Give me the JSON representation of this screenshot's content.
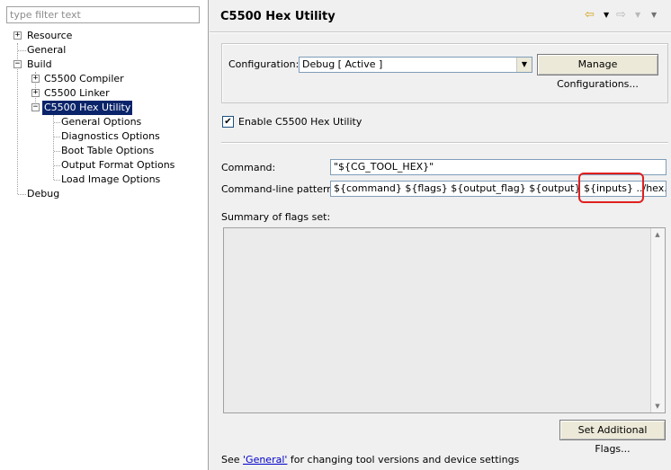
{
  "filter": {
    "placeholder": "type filter text"
  },
  "tree": {
    "resource": "Resource",
    "general": "General",
    "build": "Build",
    "compiler": "C5500 Compiler",
    "linker": "C5500 Linker",
    "hex_utility": "C5500 Hex Utility",
    "general_options": "General Options",
    "diagnostics_options": "Diagnostics Options",
    "boot_table_options": "Boot Table Options",
    "output_format_options": "Output Format Options",
    "load_image_options": "Load Image Options",
    "debug": "Debug"
  },
  "header": {
    "title": "C5500 Hex Utility",
    "icons": [
      "back-arrow-icon",
      "forward-arrow-icon",
      "view-menu-icon"
    ]
  },
  "configuration": {
    "label": "Configuration:",
    "value": "Debug  [ Active ]",
    "manage_button": "Manage Configurations..."
  },
  "enable": {
    "label": "Enable C5500 Hex Utility",
    "checked": true
  },
  "command": {
    "label": "Command:",
    "value": "\"${CG_TOOL_HEX}\""
  },
  "pattern": {
    "label": "Command-line pattern:",
    "value": "${command} ${flags} ${output_flag} ${output} ${inputs} ../hex.cmd"
  },
  "summary": {
    "label": "Summary of flags set:"
  },
  "flags_button": "Set Additional Flags...",
  "footer": {
    "prefix": "See ",
    "link": "'General'",
    "suffix": " for changing tool versions and device settings"
  },
  "colors": {
    "selection": "#0a246a",
    "highlight_outline": "#e02020",
    "link": "#0000cc"
  }
}
